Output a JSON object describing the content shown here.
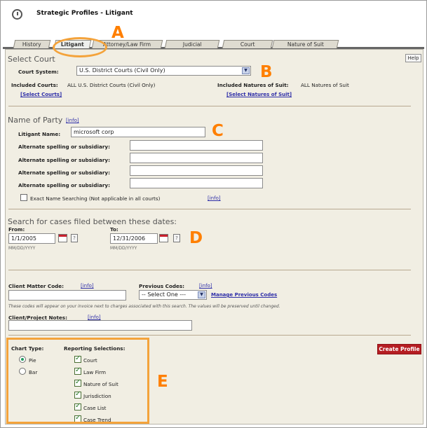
{
  "window": {
    "title": "Strategic Profiles - Litigant"
  },
  "tabs": [
    {
      "label": "History"
    },
    {
      "label": "Litigant"
    },
    {
      "label": "Attorney/Law Firm"
    },
    {
      "label": "Judicial"
    },
    {
      "label": "Court"
    },
    {
      "label": "Nature of Suit"
    }
  ],
  "help": {
    "label": "Help"
  },
  "select_court": {
    "title": "Select Court",
    "court_system_label": "Court System:",
    "court_system_value": "U.S. District Courts (Civil Only)",
    "included_courts_label": "Included Courts:",
    "included_courts_value": "ALL U.S. District Courts (Civil Only)",
    "included_natures_label": "Included Natures of Suit:",
    "included_natures_value": "ALL Natures of Suit",
    "select_courts_link": "[Select Courts]",
    "select_natures_link": "[Select Natures of Suit]"
  },
  "party": {
    "title": "Name of Party",
    "info_link": "[info]",
    "litigant_label": "Litigant Name:",
    "litigant_value": "microsoft corp",
    "alternate_label": "Alternate spelling or subsidiary:",
    "alternate_values": [
      "",
      "",
      "",
      ""
    ],
    "exact_label": "Exact Name Searching (Not applicable in all courts)",
    "exact_info": "[info]"
  },
  "dates": {
    "title": "Search for cases filed between these dates:",
    "from_label": "From:",
    "from_value": "1/1/2005",
    "to_label": "To:",
    "to_value": "12/31/2006",
    "date_format": "MM/DD/YYYY"
  },
  "client": {
    "matter_label": "Client Matter Code:",
    "matter_info": "[info]",
    "previous_label": "Previous Codes:",
    "previous_info": "[info]",
    "select_value": "-- Select One ---",
    "manage_link": "Manage Previous Codes",
    "note": "These codes will appear on your invoice next to charges associated with this search. The values will be preserved until changed.",
    "project_label": "Client/Project Notes:",
    "project_info": "[info]"
  },
  "chart": {
    "chart_type_label": "Chart Type:",
    "pie_label": "Pie",
    "bar_label": "Bar",
    "reporting_label": "Reporting Selections:",
    "selections": [
      "Court",
      "Law Firm",
      "Nature of Suit",
      "Jurisdiction",
      "Case List",
      "Case Trend"
    ]
  },
  "create_button": {
    "label": "Create Profile"
  },
  "annotations": {
    "A": "A",
    "B": "B",
    "C": "C",
    "D": "D",
    "E": "E"
  }
}
